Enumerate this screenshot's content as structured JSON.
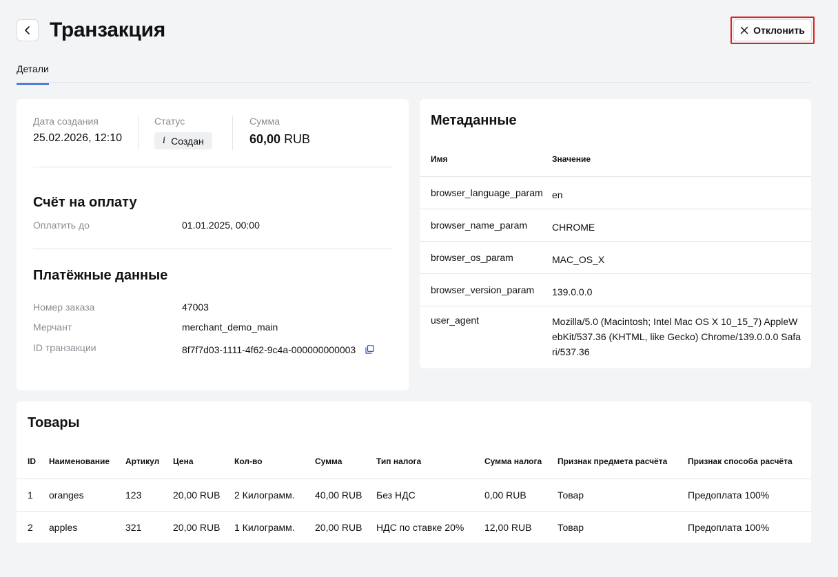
{
  "header": {
    "title": "Транзакция",
    "reject_label": "Отклонить",
    "accent_color": "#1f5bd6",
    "highlight_color": "#e01f1f"
  },
  "tabs": [
    {
      "label": "Детали",
      "active": true
    }
  ],
  "summary": {
    "created_label": "Дата создания",
    "created_value": "25.02.2026, 12:10",
    "status_label": "Статус",
    "status_value": "Создан",
    "amount_label": "Сумма",
    "amount_value": "60,00",
    "amount_currency": "RUB"
  },
  "invoice": {
    "title": "Счёт на оплату",
    "pay_until_label": "Оплатить до",
    "pay_until_value": "01.01.2025, 00:00"
  },
  "payment": {
    "title": "Платёжные данные",
    "order_label": "Номер заказа",
    "order_value": "47003",
    "merchant_label": "Мерчант",
    "merchant_value": "merchant_demo_main",
    "txid_label": "ID транзакции",
    "txid_value": "8f7f7d03-1111-4f62-9c4a-000000000003"
  },
  "metadata": {
    "title": "Метаданные",
    "col_name": "Имя",
    "col_value": "Значение",
    "rows": [
      {
        "name": "browser_language_param",
        "value": "en"
      },
      {
        "name": "browser_name_param",
        "value": "CHROME"
      },
      {
        "name": "browser_os_param",
        "value": "MAC_OS_X"
      },
      {
        "name": "browser_version_param",
        "value": "139.0.0.0"
      },
      {
        "name": "user_agent",
        "value": "Mozilla/5.0 (Macintosh; Intel Mac OS X 10_15_7) AppleWebKit/537.36 (KHTML, like Gecko) Chrome/139.0.0.0 Safari/537.36"
      }
    ]
  },
  "goods": {
    "title": "Товары",
    "columns": [
      "ID",
      "Наименование",
      "Артикул",
      "Цена",
      "Кол-во",
      "Сумма",
      "Тип налога",
      "Сумма налога",
      "Признак предмета расчёта",
      "Признак способа расчёта"
    ],
    "rows": [
      [
        "1",
        "oranges",
        "123",
        "20,00 RUB",
        "2 Килограмм.",
        "40,00 RUB",
        "Без НДС",
        "0,00 RUB",
        "Товар",
        "Предоплата 100%"
      ],
      [
        "2",
        "apples",
        "321",
        "20,00 RUB",
        "1 Килограмм.",
        "20,00 RUB",
        "НДС по ставке 20%",
        "12,00 RUB",
        "Товар",
        "Предоплата 100%"
      ]
    ]
  }
}
